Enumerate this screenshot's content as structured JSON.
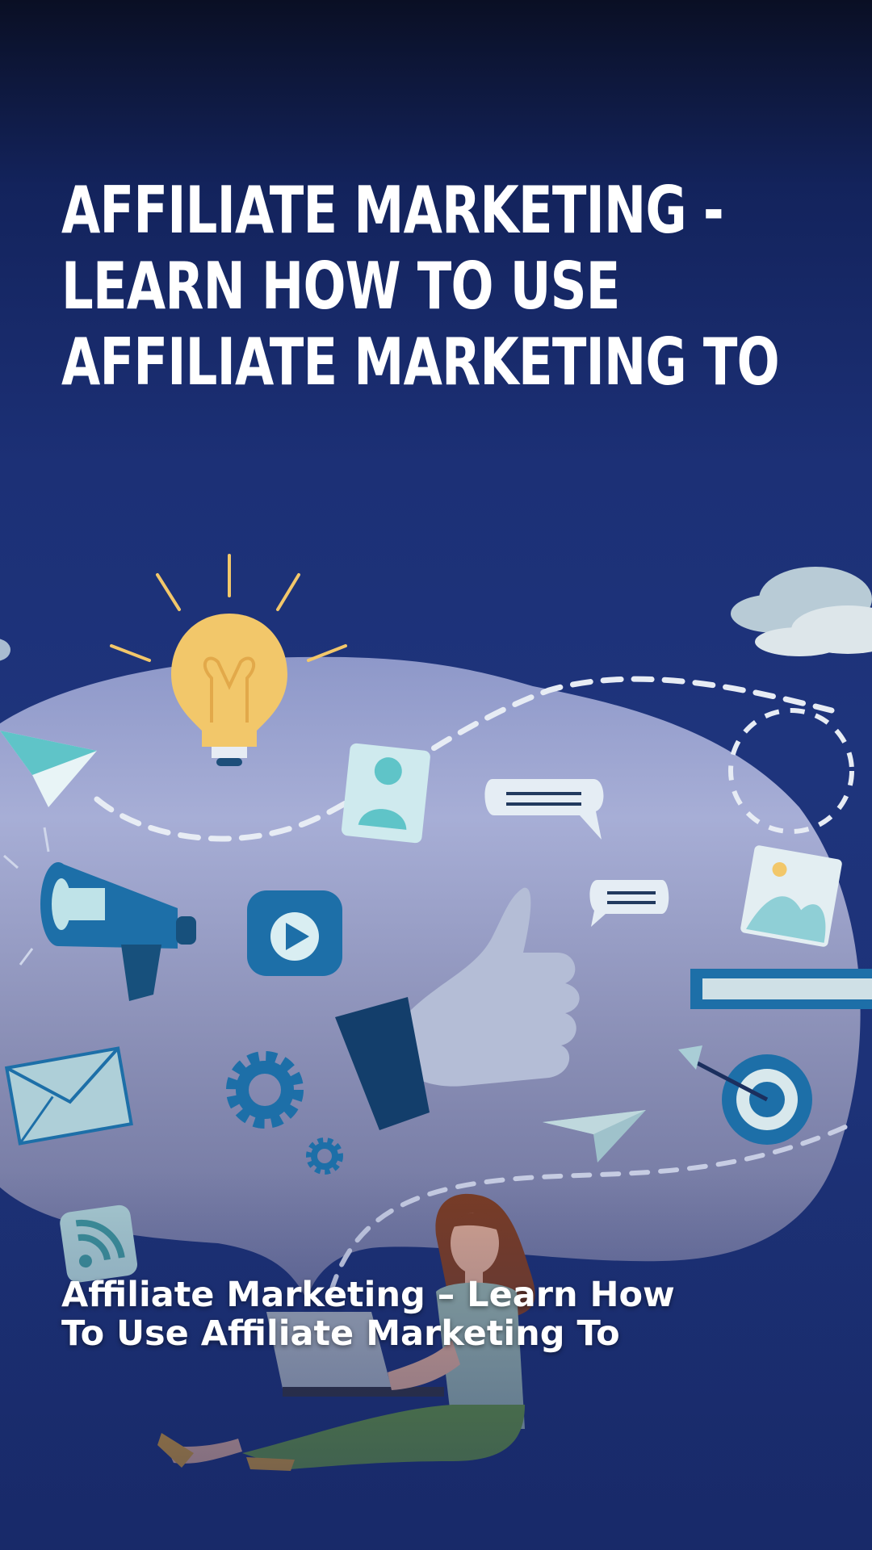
{
  "headline": {
    "lines": [
      "AFFILIATE MARKETING -",
      "LEARN HOW TO USE",
      "AFFILIATE MARKETING TO"
    ]
  },
  "subtitle": {
    "lines": [
      "Affiliate Marketing – Learn How",
      "To Use Affiliate Marketing To"
    ]
  },
  "illustration": {
    "icons": [
      "lightbulb-icon",
      "paper-plane-icon",
      "profile-card-icon",
      "chat-bubble-icon",
      "megaphone-icon",
      "video-play-icon",
      "thumbs-up-icon",
      "image-icon",
      "search-bar-icon",
      "envelope-icon",
      "gear-icon",
      "target-icon",
      "rss-icon",
      "cloud-icon",
      "woman-with-laptop"
    ]
  },
  "colors": {
    "background_top": "#0a0f24",
    "background_mid": "#1e347c",
    "blob": "#a9b0d8",
    "accent_blue": "#1d6fa8",
    "bulb_yellow": "#f2c76a",
    "text": "#ffffff"
  }
}
